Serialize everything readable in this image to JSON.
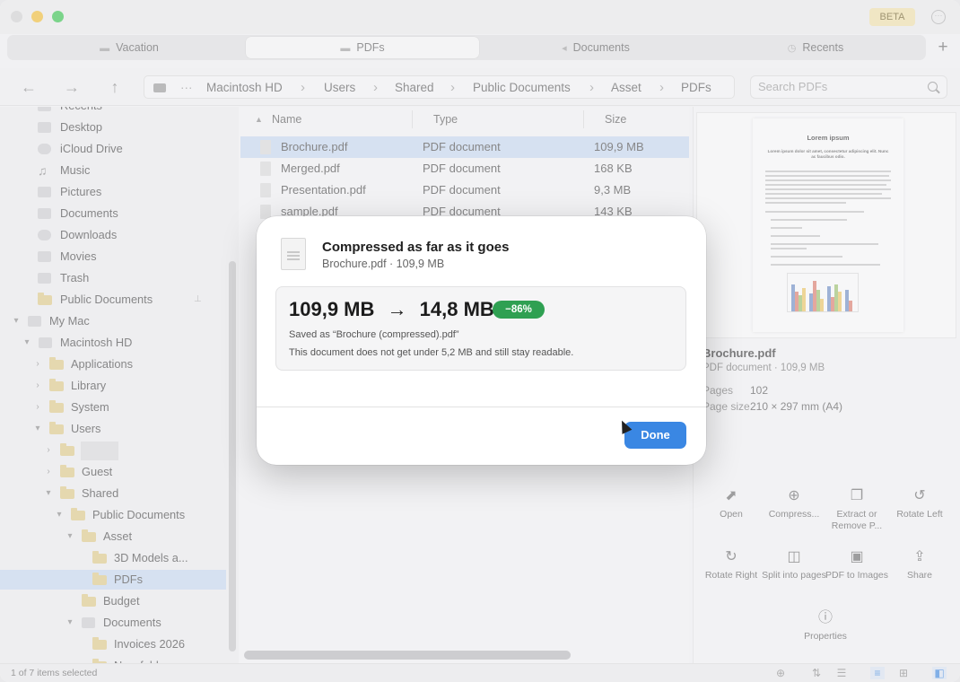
{
  "window": {
    "beta_label": "BETA"
  },
  "tabs": [
    {
      "label": "Vacation"
    },
    {
      "label": "PDFs"
    },
    {
      "label": "Documents"
    },
    {
      "label": "Recents"
    }
  ],
  "path": {
    "ellipsis": "···",
    "crumbs": [
      "Macintosh HD",
      "Users",
      "Shared",
      "Public Documents",
      "Asset",
      "PDFs"
    ]
  },
  "search": {
    "placeholder": "Search PDFs"
  },
  "sidebar": {
    "items": [
      {
        "label": "Recents"
      },
      {
        "label": "Desktop"
      },
      {
        "label": "iCloud Drive"
      },
      {
        "label": "Music"
      },
      {
        "label": "Pictures"
      },
      {
        "label": "Documents"
      },
      {
        "label": "Downloads"
      },
      {
        "label": "Movies"
      },
      {
        "label": "Trash"
      },
      {
        "label": "Public Documents"
      },
      {
        "label": "My Mac"
      },
      {
        "label": "Macintosh HD"
      },
      {
        "label": "Applications"
      },
      {
        "label": "Library"
      },
      {
        "label": "System"
      },
      {
        "label": "Users"
      },
      {
        "label": ""
      },
      {
        "label": "Guest"
      },
      {
        "label": "Shared"
      },
      {
        "label": "Public Documents"
      },
      {
        "label": "Asset"
      },
      {
        "label": "3D Models a..."
      },
      {
        "label": "PDFs"
      },
      {
        "label": "Budget"
      },
      {
        "label": "Documents"
      },
      {
        "label": "Invoices 2026"
      },
      {
        "label": "New folder"
      }
    ]
  },
  "filelist": {
    "headers": {
      "name": "Name",
      "type": "Type",
      "size": "Size"
    },
    "rows": [
      {
        "name": "Brochure.pdf",
        "type": "PDF document",
        "size": "109,9 MB"
      },
      {
        "name": "Merged.pdf",
        "type": "PDF document",
        "size": "168 KB"
      },
      {
        "name": "Presentation.pdf",
        "type": "PDF document",
        "size": "9,3 MB"
      },
      {
        "name": "sample.pdf",
        "type": "PDF document",
        "size": "143 KB"
      }
    ]
  },
  "preview": {
    "page_title": "Lorem ipsum",
    "page_subtitle": "Lorem ipsum dolor sit amet, consectetur adipiscing elit. Nunc ac faucibus odio.",
    "filename": "Brochure.pdf",
    "kind": "PDF document · 109,9 MB",
    "pages_label": "Pages",
    "pages_value": "102",
    "pagesize_label": "Page size",
    "pagesize_value": "210 × 297 mm (A4)",
    "actions": [
      {
        "label": "Open"
      },
      {
        "label": "Compress..."
      },
      {
        "label": "Extract or Remove P..."
      },
      {
        "label": "Rotate Left"
      },
      {
        "label": "Rotate Right"
      },
      {
        "label": "Split into pages"
      },
      {
        "label": "PDF to Images"
      },
      {
        "label": "Share"
      },
      {
        "label": "Properties"
      }
    ]
  },
  "status": {
    "text": "1 of 7 items selected"
  },
  "dialog": {
    "title": "Compressed as far as it goes",
    "subtitle": "Brochure.pdf · 109,9 MB",
    "from_size": "109,9 MB",
    "arrow": "→",
    "to_size": "14,8 MB",
    "reduction": "−86%",
    "saved_as": "Saved as “Brochure (compressed).pdf”",
    "note": "This document does not get under 5,2 MB and still stay readable.",
    "done_label": "Done"
  },
  "colors": {
    "accent": "#3a87e3",
    "badge": "#2fa052",
    "selection": "#c9dbf3",
    "folder": "#e2cb85"
  }
}
